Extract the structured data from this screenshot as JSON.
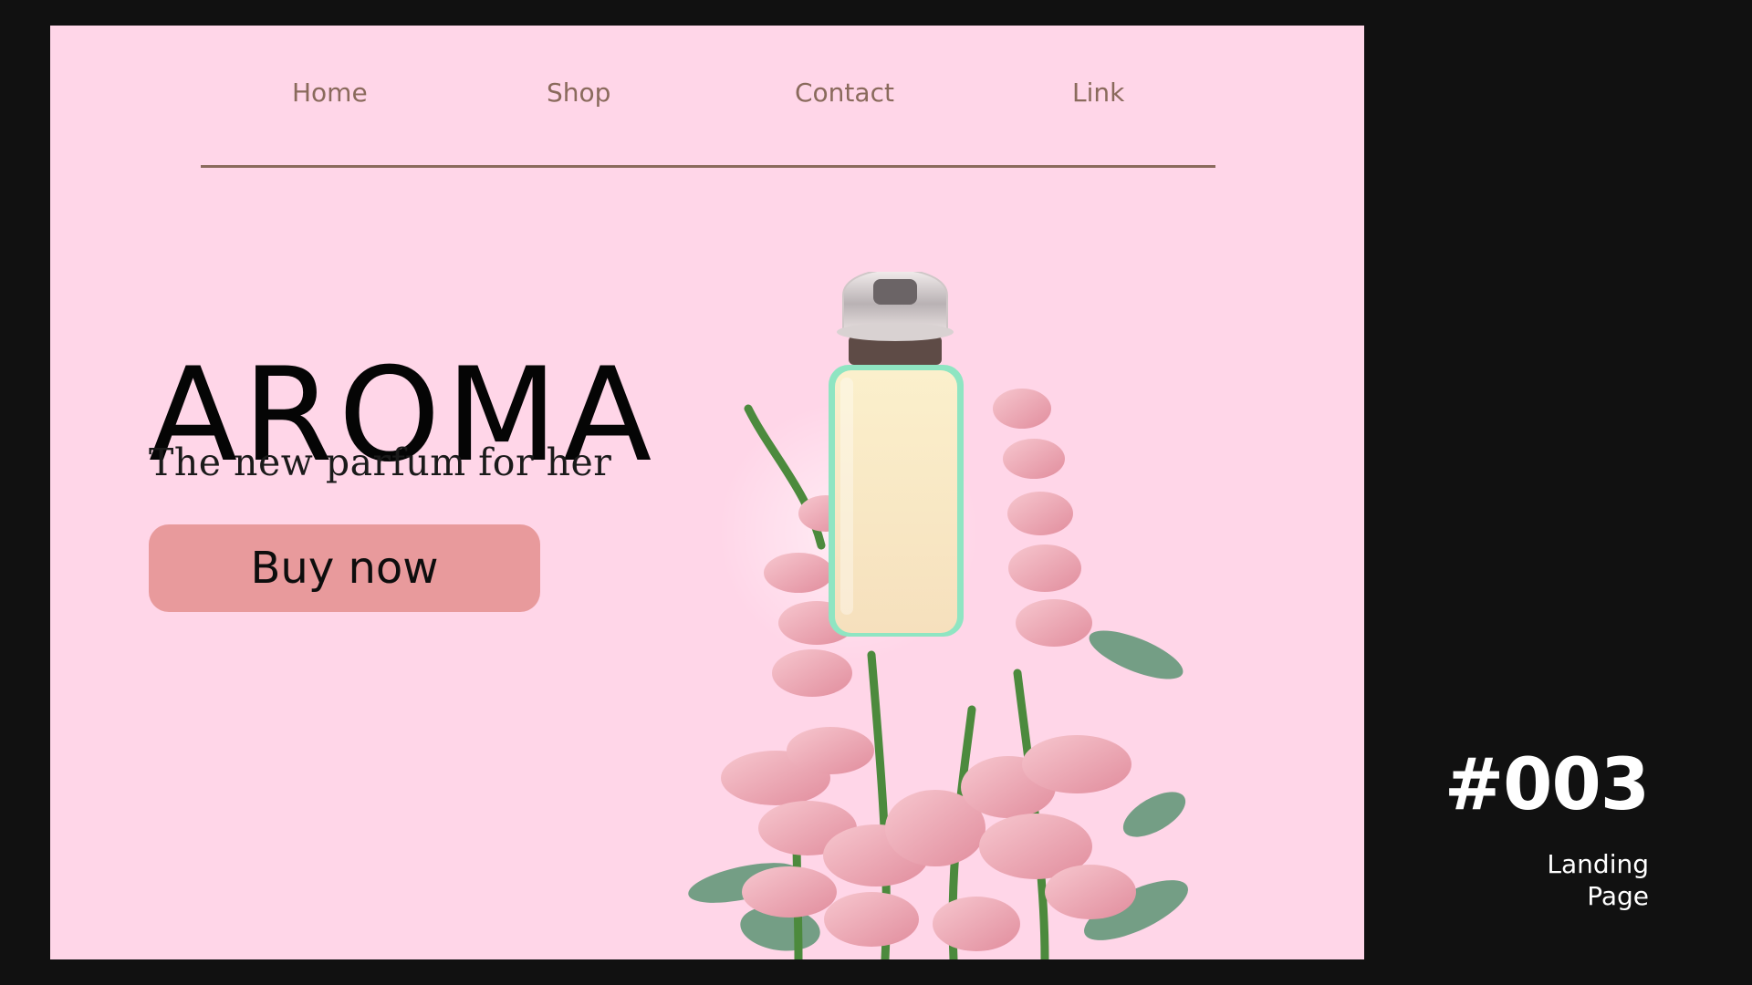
{
  "nav": {
    "items": [
      {
        "label": "Home"
      },
      {
        "label": "Shop"
      },
      {
        "label": "Contact"
      },
      {
        "label": "Link"
      }
    ]
  },
  "hero": {
    "title": "AROMA",
    "subtitle": "The new parfum for her",
    "cta_label": "Buy now"
  },
  "badge": {
    "number": "#003",
    "label": "Landing Page"
  },
  "colors": {
    "page_background": "#111111",
    "canvas_background": "#ffd6e8",
    "nav_text": "#8a6a5c",
    "button": "#e89a9c"
  },
  "image": {
    "icon": "perfume-bottle-with-flowers"
  }
}
